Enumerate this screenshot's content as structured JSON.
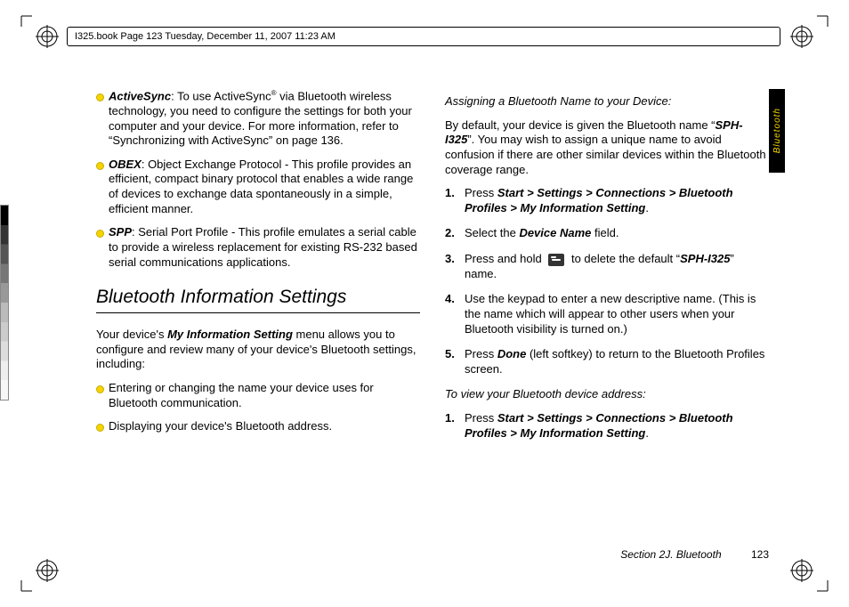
{
  "meta": {
    "header_strip": "I325.book  Page 123  Tuesday, December 11, 2007  11:23 AM",
    "side_tab": "Bluetooth",
    "footer_section": "Section 2J. Bluetooth",
    "footer_page": "123"
  },
  "left": {
    "bullets": [
      {
        "term": "ActiveSync",
        "rest": ": To use ActiveSync",
        "sup": "®",
        "tail": " via Bluetooth wireless technology, you need to configure the settings for both your computer and your device. For more information, refer to “Synchronizing with ActiveSync” on page 136."
      },
      {
        "term": "OBEX",
        "rest": ": Object Exchange Protocol - This profile provides an efficient, compact binary protocol that enables a wide range of devices to exchange data spontaneously in a simple, efficient manner.",
        "sup": "",
        "tail": ""
      },
      {
        "term": "SPP",
        "rest": ": Serial Port Profile - This profile emulates a serial cable to provide a wireless replacement for existing RS-232 based serial communications applications.",
        "sup": "",
        "tail": ""
      }
    ],
    "heading": "Bluetooth Information Settings",
    "intro_a": "Your device's ",
    "intro_b": "My Information Setting",
    "intro_c": " menu allows you to configure and review many of your device's Bluetooth settings, including:",
    "bullets2": [
      "Entering or changing the name your device uses for Bluetooth communication.",
      "Displaying your device's Bluetooth address."
    ]
  },
  "right": {
    "sub1": "Assigning a Bluetooth Name to your Device:",
    "p1_a": "By default, your device is given the Bluetooth name “",
    "p1_b": "SPH-I325",
    "p1_c": "”. You may wish to assign a unique name to avoid confusion if there are other similar devices within the Bluetooth coverage range.",
    "s1_a": "Press ",
    "s1_b": "Start > Settings > Connections > Bluetooth Profiles > My Information Setting",
    "s1_c": ".",
    "s2_a": "Select the ",
    "s2_b": "Device Name",
    "s2_c": " field.",
    "s3_a": "Press and hold ",
    "s3_b": " to delete the default “",
    "s3_c": "SPH-I325",
    "s3_d": "” name.",
    "s4": "Use the keypad to enter a new descriptive name. (This is the name which will appear to other users when your Bluetooth visibility is turned on.)",
    "s5_a": "Press ",
    "s5_b": "Done",
    "s5_c": " (left softkey) to return to the Bluetooth Profiles screen.",
    "sub2": "To view your Bluetooth device address:",
    "t1_a": "Press ",
    "t1_b": "Start > Settings > Connections > Bluetooth Profiles > My Information Setting",
    "t1_c": "."
  }
}
